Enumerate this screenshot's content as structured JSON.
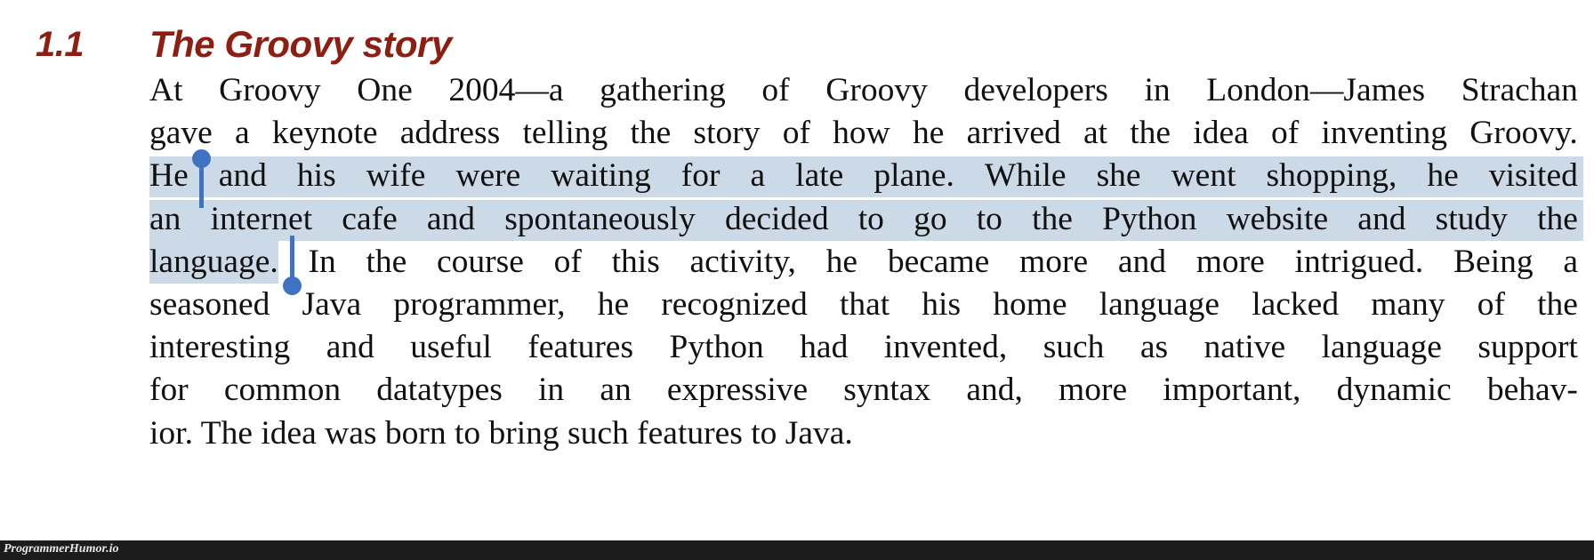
{
  "page": {
    "background_color": "#ffffff",
    "heading_color": "#8e1e12",
    "body_text_color": "#111111",
    "selection_highlight_color": "#ccd9e6",
    "selection_handle_color": "#3f72c0"
  },
  "heading": {
    "number": "1.1",
    "title": "The Groovy story"
  },
  "paragraph": {
    "full_text": "At Groovy One 2004—a gathering of Groovy developers in London—James Strachan gave a keynote address telling the story of how he arrived at the idea of inventing Groovy. He and his wife were waiting for a late plane. While she went shopping, he visited an internet cafe and spontaneously decided to go to the Python website and study the language. In the course of this activity, he became more and more intrigued. Being a seasoned Java programmer, he recognized that his home language lacked many of the interesting and useful features Python had invented, such as native language support for common datatypes in an expressive syntax and, more important, dynamic behavior. The idea was born to bring such features to Java.",
    "lines": [
      {
        "id": "line-1",
        "justified": true,
        "highlight": "none",
        "words": [
          "At",
          "Groovy",
          "One",
          "2004—a",
          "gathering",
          "of",
          "Groovy",
          "developers",
          "in",
          "London—James",
          "Strachan"
        ]
      },
      {
        "id": "line-2",
        "justified": true,
        "highlight": "none",
        "words": [
          "gave",
          "a",
          "keynote",
          "address",
          "telling",
          "the",
          "story",
          "of",
          "how",
          "he",
          "arrived",
          "at",
          "the",
          "idea",
          "of",
          "inventing",
          "Groovy."
        ]
      },
      {
        "id": "line-3",
        "justified": true,
        "highlight": "full",
        "words": [
          "He",
          "and",
          "his",
          "wife",
          "were",
          "waiting",
          "for",
          "a",
          "late",
          "plane.",
          "While",
          "she",
          "went",
          "shopping,",
          "he",
          "visited"
        ]
      },
      {
        "id": "line-4",
        "justified": true,
        "highlight": "full",
        "words": [
          "an",
          "internet",
          "cafe",
          "and",
          "spontaneously",
          "decided",
          "to",
          "go",
          "to",
          "the",
          "Python",
          "website",
          "and",
          "study",
          "the"
        ]
      },
      {
        "id": "line-5",
        "justified": true,
        "highlight": "partial",
        "highlighted_text": "language.",
        "words": [
          "language.",
          "In",
          "the",
          "course",
          "of",
          "this",
          "activity,",
          "he",
          "became",
          "more",
          "and",
          "more",
          "intrigued.",
          "Being",
          "a"
        ]
      },
      {
        "id": "line-6",
        "justified": true,
        "highlight": "none",
        "words": [
          "seasoned",
          "Java",
          "programmer,",
          "he",
          "recognized",
          "that",
          "his",
          "home",
          "language",
          "lacked",
          "many",
          "of",
          "the"
        ]
      },
      {
        "id": "line-7",
        "justified": true,
        "highlight": "none",
        "words": [
          "interesting",
          "and",
          "useful",
          "features",
          "Python",
          "had",
          "invented,",
          "such",
          "as",
          "native",
          "language",
          "support"
        ]
      },
      {
        "id": "line-8",
        "justified": true,
        "highlight": "none",
        "words": [
          "for",
          "common",
          "datatypes",
          "in",
          "an",
          "expressive",
          "syntax",
          "and,",
          "more",
          "important,",
          "dynamic",
          "behav-"
        ]
      },
      {
        "id": "line-9",
        "justified": false,
        "highlight": "none",
        "text": "ior. The idea was born to bring such features to Java."
      }
    ]
  },
  "selection": {
    "selected_text": "He and his wife were waiting for a late plane. While she went shopping, he visited an internet cafe and spontaneously decided to go to the Python website and study the language.",
    "start_handle": "text-selection-start-handle",
    "end_handle": "text-selection-end-handle"
  },
  "watermark": {
    "text": "ProgrammerHumor.io"
  }
}
